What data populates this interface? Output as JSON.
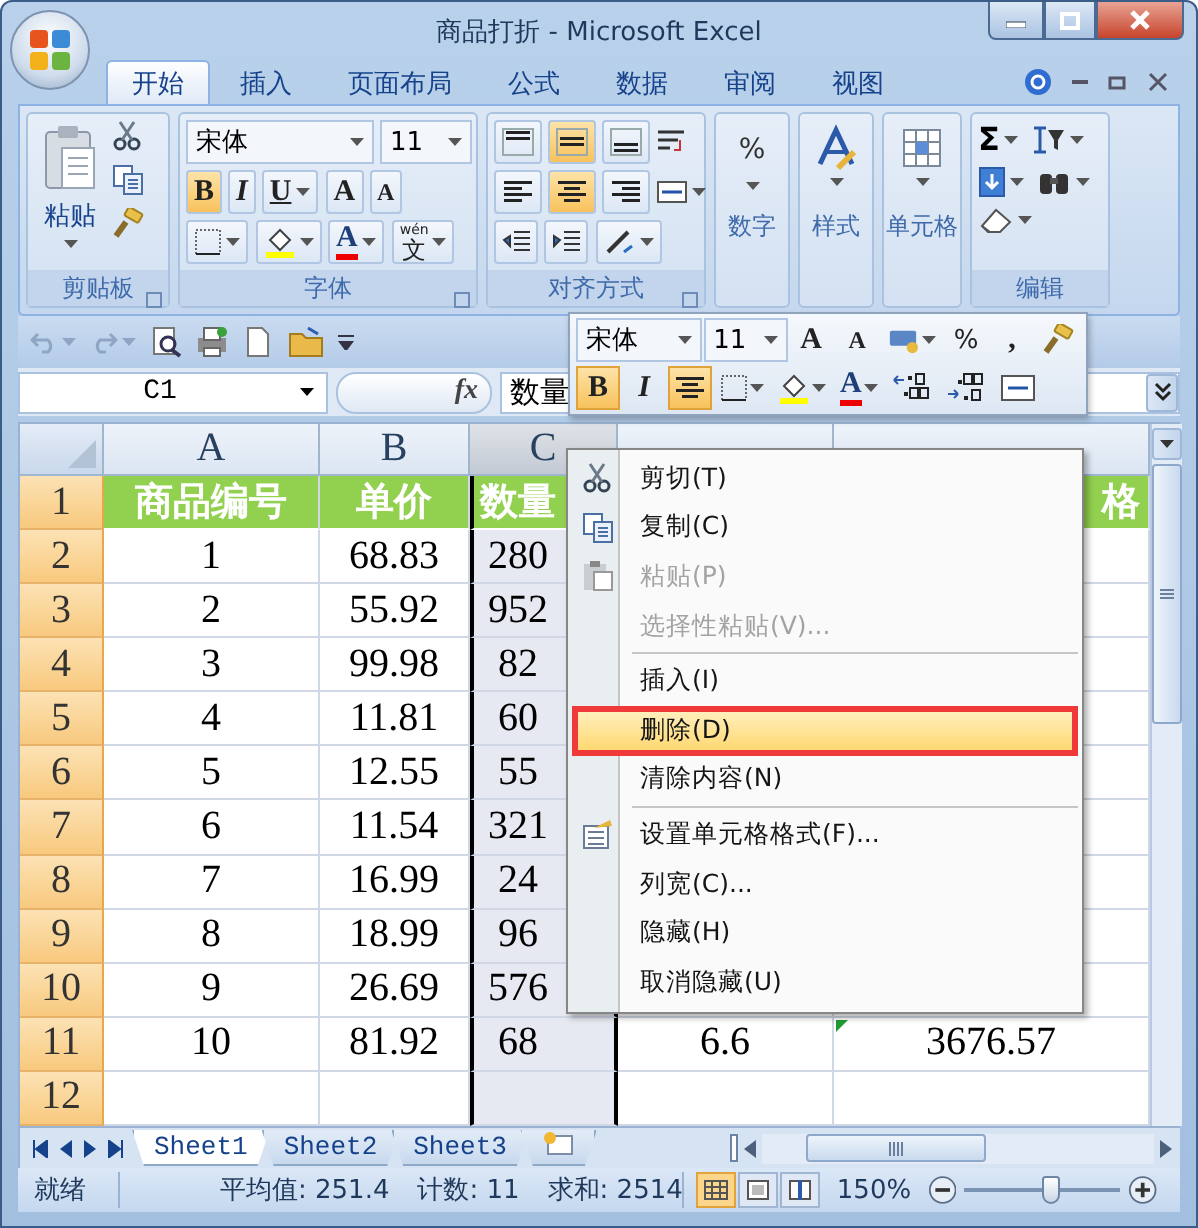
{
  "window": {
    "title": "商品打折 - Microsoft Excel"
  },
  "tabs": [
    {
      "label": "开始",
      "selected": true
    },
    {
      "label": "插入",
      "selected": false
    },
    {
      "label": "页面布局",
      "selected": false
    },
    {
      "label": "公式",
      "selected": false
    },
    {
      "label": "数据",
      "selected": false
    },
    {
      "label": "审阅",
      "selected": false
    },
    {
      "label": "视图",
      "selected": false
    }
  ],
  "ribbon": {
    "clipboard": {
      "label": "剪贴板",
      "paste": "粘贴"
    },
    "font": {
      "label": "字体",
      "font_name": "宋体",
      "font_size": "11",
      "bold": {
        "text": "B",
        "selected": true
      },
      "italic": {
        "text": "I",
        "selected": false
      },
      "underline": {
        "text": "U",
        "selected": false
      },
      "grow": "A",
      "shrink": "A",
      "font_color": "A",
      "phonetic_top": "wén",
      "phonetic": "文"
    },
    "alignment": {
      "label": "对齐方式",
      "vertical": [
        {
          "selected": false
        },
        {
          "selected": true
        },
        {
          "selected": false
        }
      ],
      "horizontal": [
        {
          "selected": false
        },
        {
          "selected": true
        },
        {
          "selected": false
        }
      ]
    },
    "number": {
      "label": "数字",
      "symbol": "%"
    },
    "styles": {
      "label": "样式"
    },
    "cells": {
      "label": "单元格"
    },
    "editing": {
      "label": "编辑",
      "sum": "Σ"
    }
  },
  "formula_bar": {
    "name_box": "C1",
    "function_label": "fx",
    "content": "数量"
  },
  "mini_toolbar": {
    "font_name": "宋体",
    "font_size": "11",
    "grow": "A",
    "shrink": "A",
    "percent": "%",
    "comma": ",",
    "bold": {
      "text": "B",
      "selected": true
    },
    "italic": {
      "text": "I",
      "selected": false
    },
    "center": {
      "selected": true
    },
    "font_color": "A"
  },
  "columns": [
    {
      "label": "A",
      "selected": false
    },
    {
      "label": "B",
      "selected": false
    },
    {
      "label": "C",
      "selected": true
    }
  ],
  "rows": [
    {
      "number": "1",
      "kind": "header",
      "a": "商品编号",
      "b": "单价",
      "c": "数量",
      "e": "格"
    },
    {
      "number": "2",
      "kind": "data",
      "a": "1",
      "b": "68.83",
      "c": "280"
    },
    {
      "number": "3",
      "kind": "data",
      "a": "2",
      "b": "55.92",
      "c": "952"
    },
    {
      "number": "4",
      "kind": "data",
      "a": "3",
      "b": "99.98",
      "c": "82"
    },
    {
      "number": "5",
      "kind": "data",
      "a": "4",
      "b": "11.81",
      "c": "60"
    },
    {
      "number": "6",
      "kind": "data",
      "a": "5",
      "b": "12.55",
      "c": "55"
    },
    {
      "number": "7",
      "kind": "data",
      "a": "6",
      "b": "11.54",
      "c": "321"
    },
    {
      "number": "8",
      "kind": "data",
      "a": "7",
      "b": "16.99",
      "c": "24"
    },
    {
      "number": "9",
      "kind": "data",
      "a": "8",
      "b": "18.99",
      "c": "96"
    },
    {
      "number": "10",
      "kind": "data",
      "a": "9",
      "b": "26.69",
      "c": "576"
    },
    {
      "number": "11",
      "kind": "data",
      "a": "10",
      "b": "81.92",
      "c": "68",
      "d": "6.6",
      "e": "3676.57",
      "e_flag": true
    },
    {
      "number": "12",
      "kind": "data"
    }
  ],
  "context_menu": [
    {
      "kind": "item",
      "label": "剪切(T)",
      "disabled": false,
      "selected": false
    },
    {
      "kind": "item",
      "label": "复制(C)",
      "disabled": false,
      "selected": false
    },
    {
      "kind": "item",
      "label": "粘贴(P)",
      "disabled": true,
      "selected": false
    },
    {
      "kind": "item",
      "label": "选择性粘贴(V)...",
      "disabled": true,
      "selected": false
    },
    {
      "kind": "separator"
    },
    {
      "kind": "item",
      "label": "插入(I)",
      "disabled": false,
      "selected": false
    },
    {
      "kind": "item",
      "label": "删除(D)",
      "disabled": false,
      "selected": true
    },
    {
      "kind": "item",
      "label": "清除内容(N)",
      "disabled": false,
      "selected": false
    },
    {
      "kind": "separator"
    },
    {
      "kind": "item",
      "label": "设置单元格格式(F)...",
      "disabled": false,
      "selected": false
    },
    {
      "kind": "item",
      "label": "列宽(C)...",
      "disabled": false,
      "selected": false
    },
    {
      "kind": "item",
      "label": "隐藏(H)",
      "disabled": false,
      "selected": false
    },
    {
      "kind": "item",
      "label": "取消隐藏(U)",
      "disabled": false,
      "selected": false
    }
  ],
  "sheet_tabs": [
    {
      "label": "Sheet1",
      "selected": true
    },
    {
      "label": "Sheet2",
      "selected": false
    },
    {
      "label": "Sheet3",
      "selected": false
    }
  ],
  "status_bar": {
    "ready": "就绪",
    "average": "平均值: 251.4",
    "count": "计数: 11",
    "sum": "求和: 2514",
    "views": [
      {
        "kind": "normal",
        "selected": true
      },
      {
        "kind": "page-layout",
        "selected": false
      },
      {
        "kind": "page-break",
        "selected": false
      }
    ],
    "zoom": "150%",
    "zoom_slider": {
      "level": 0.55
    }
  }
}
